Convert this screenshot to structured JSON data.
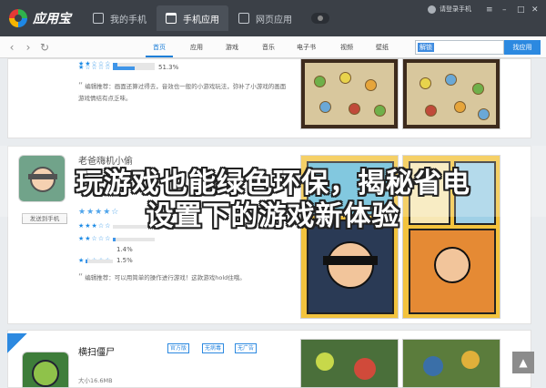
{
  "app": {
    "name": "应用宝"
  },
  "top_tabs": [
    {
      "label": "我的手机",
      "icon": "phone-icon"
    },
    {
      "label": "手机应用",
      "icon": "app-icon"
    },
    {
      "label": "网页应用",
      "icon": "web-icon"
    }
  ],
  "login_label": "请登录手机",
  "nav_items": [
    "首页",
    "应用",
    "游戏",
    "音乐",
    "电子书",
    "视频",
    "壁纸"
  ],
  "active_nav": "首页",
  "search": {
    "value": "解锁",
    "button": "找应用"
  },
  "card1": {
    "ratings": [
      {
        "stars": "★★☆☆☆",
        "percent": 10
      },
      {
        "stars": "★☆☆☆☆",
        "percent": 51.3,
        "label": "51.3%"
      }
    ],
    "review_lines": [
      "编辑推荐：画面还算过得去，音效也一般的小游戏玩法，弥补了小游戏的画面",
      "游戏情结有点乏味。"
    ]
  },
  "card2": {
    "title": "老爸嗨机小偷",
    "send_button": "发送到手机",
    "ratings": [
      {
        "stars": "★★★★☆",
        "percent": 0
      },
      {
        "stars": "★★★☆☆",
        "percent": 0
      },
      {
        "stars": "★★☆☆☆",
        "percent": 6,
        "label": "1.4%"
      },
      {
        "stars": "★☆☆☆☆",
        "percent": 7,
        "label": "1.5%"
      }
    ],
    "review": "编辑推荐：可以用简单的操作进行游戏！这款游戏hold住哦。"
  },
  "card3": {
    "title": "横扫僵尸",
    "size": "大小16.6MB",
    "badges": [
      "官方版",
      "无病毒",
      "无广告"
    ]
  },
  "headline": {
    "line1": "玩游戏也能绿色环保，揭秘省电",
    "line2": "设置下的游戏新体验"
  }
}
